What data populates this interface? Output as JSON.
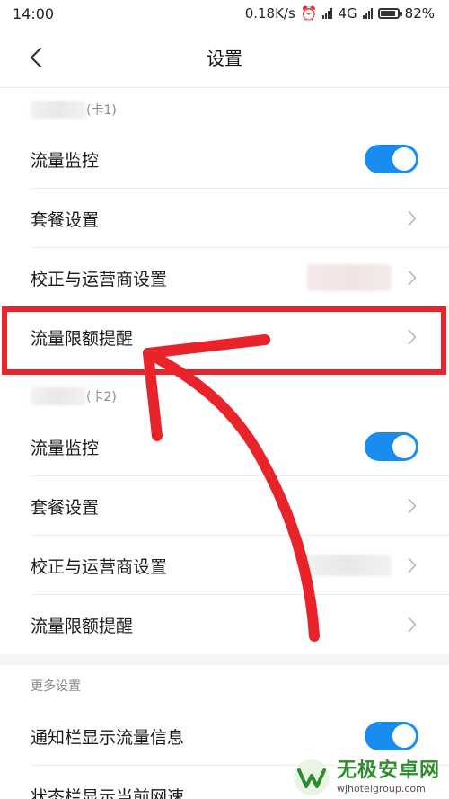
{
  "status_bar": {
    "time": "14:00",
    "speed": "0.18K/s",
    "network": "4G",
    "battery": "82%",
    "battery_level": 0.82
  },
  "nav": {
    "title": "设置"
  },
  "sim1": {
    "label": "(卡1)",
    "rows": [
      {
        "label": "流量监控"
      },
      {
        "label": "套餐设置"
      },
      {
        "label": "校正与运营商设置"
      },
      {
        "label": "流量限额提醒"
      }
    ]
  },
  "sim2": {
    "label": "(卡2)",
    "rows": [
      {
        "label": "流量监控"
      },
      {
        "label": "套餐设置"
      },
      {
        "label": "校正与运营商设置"
      },
      {
        "label": "流量限额提醒"
      }
    ]
  },
  "more": {
    "header": "更多设置",
    "rows": [
      {
        "label": "通知栏显示流量信息"
      },
      {
        "label": "状态栏显示当前网速"
      }
    ]
  },
  "watermark": {
    "title": "无极安卓网",
    "url": "wjhotelgroup.com"
  },
  "colors": {
    "accent": "#1a8cf0",
    "annotation": "#e8232a"
  }
}
